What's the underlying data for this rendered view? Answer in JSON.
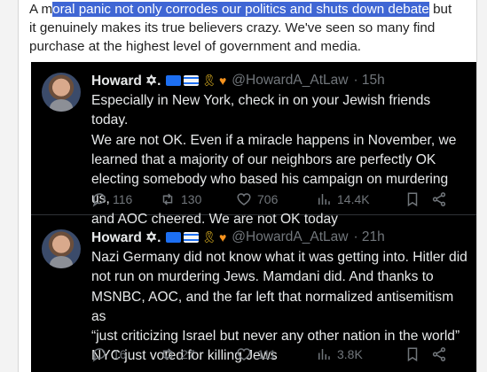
{
  "intro": {
    "line1_prefix": "A m",
    "line1_highlight": "oral panic not only corrodes our politics and shuts down debate",
    "line1_suffix": " but",
    "line2": "it genuinely makes its true believers crazy. We've seen so many find",
    "line3": "purchase at the highest level of government and media."
  },
  "tweets": [
    {
      "name": "Howard",
      "symbol": "✡.",
      "handle": "@HowardA_AtLaw",
      "time": "· 15h",
      "lines": [
        "Especially in New York, check in on your Jewish friends today.",
        "We are not OK. Even if a miracle happens in November, we",
        "learned that a majority of our neighbors are perfectly OK",
        "electing somebody who based his campaign on murdering us,",
        "and AOC cheered. We are not OK today"
      ],
      "replies": "116",
      "reposts": "130",
      "likes": "706",
      "views": "14.4K"
    },
    {
      "name": "Howard",
      "symbol": "✡.",
      "handle": "@HowardA_AtLaw",
      "time": "· 21h",
      "lines": [
        "Nazi Germany did not know what it was getting into. Hitler did",
        "not run on murdering Jews. Mamdani did.  And thanks to",
        "MSNBC, AOC, and the far left that normalized antisemitism as",
        "“just criticizing Israel but never any other nation in the world”",
        "NYC just voted for killing Jews"
      ],
      "replies": "16",
      "reposts": "27",
      "likes": "111",
      "views": "3.8K"
    }
  ],
  "colors": {
    "highlight": "#3f66d4",
    "tweet_bg": "#000000",
    "text_primary": "#e7e9ea",
    "text_secondary": "#71767b"
  }
}
